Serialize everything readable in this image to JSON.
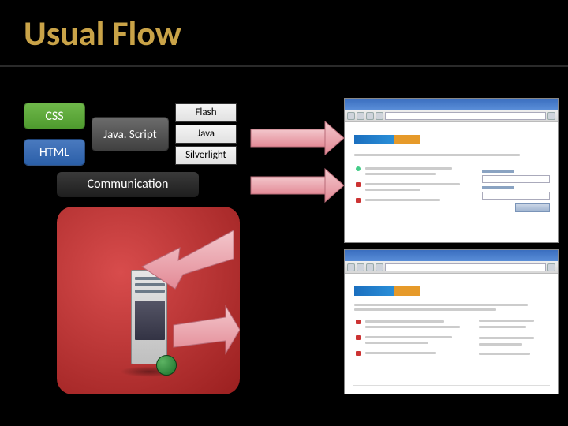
{
  "title": "Usual Flow",
  "stack": {
    "css": "CSS",
    "html": "HTML",
    "js": "Java. Script",
    "flash": "Flash",
    "java": "Java",
    "silverlight": "Silverlight"
  },
  "communication": "Communication",
  "icons": {
    "server": "server-tower",
    "globe": "globe"
  }
}
